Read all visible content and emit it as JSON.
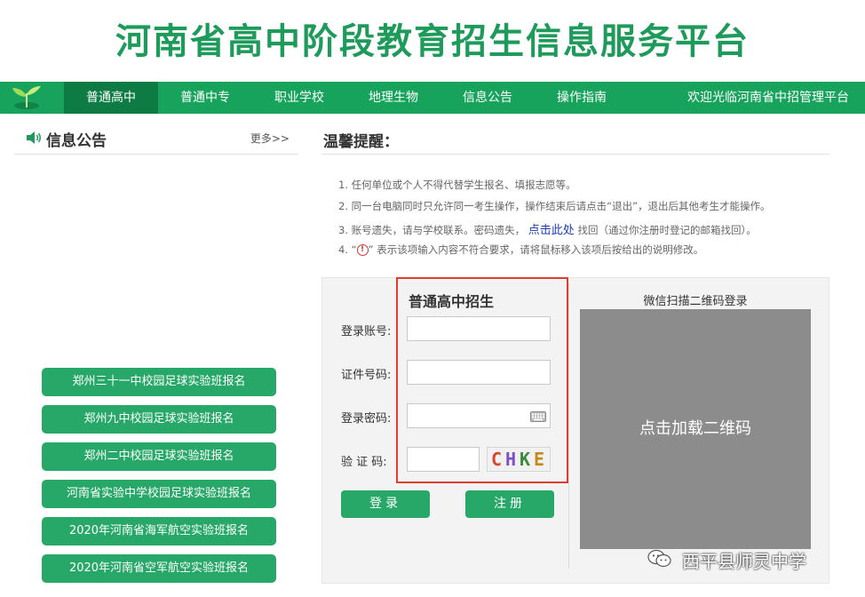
{
  "header": {
    "title": "河南省高中阶段教育招生信息服务平台"
  },
  "nav": {
    "items": [
      {
        "label": "普通高中",
        "active": true
      },
      {
        "label": "普通中专",
        "active": false
      },
      {
        "label": "职业学校",
        "active": false
      },
      {
        "label": "地理生物",
        "active": false
      },
      {
        "label": "信息公告",
        "active": false
      },
      {
        "label": "操作指南",
        "active": false
      }
    ],
    "welcome": "欢迎光临河南省中招管理平台"
  },
  "notice": {
    "title": "信息公告",
    "more": "更多>>"
  },
  "side_buttons": [
    "郑州三十一中校园足球实验班报名",
    "郑州九中校园足球实验班报名",
    "郑州二中校园足球实验班报名",
    "河南省实验中学校园足球实验班报名",
    "2020年河南省海军航空实验班报名",
    "2020年河南省空军航空实验班报名"
  ],
  "tips": {
    "title": "温馨提醒：",
    "line1": "1. 任何单位或个人不得代替学生报名、填报志愿等。",
    "line2": "2. 同一台电脑同时只允许同一考生操作，操作结束后请点击“退出”，退出后其他考生才能操作。",
    "line3_pre": "3. 账号遗失，请与学校联系。密码遗失，",
    "line3_link": "点击此处",
    "line3_post": "找回（通过你注册时登记的邮箱找回）。",
    "line4_pre": "4. “",
    "line4_icon": "!",
    "line4_post": "” 表示该项输入内容不符合要求，请将鼠标移入该项后按给出的说明修改。"
  },
  "login": {
    "title": "普通高中招生",
    "account_label": "登录账号:",
    "id_label": "证件号码:",
    "password_label": "登录密码:",
    "captcha_label": "验 证 码:",
    "captcha_chars": [
      "C",
      "H",
      "K",
      "E"
    ],
    "login_button": "登录",
    "register_button": "注册"
  },
  "qr": {
    "label": "微信扫描二维码登录",
    "load_text": "点击加载二维码"
  },
  "watermark": {
    "text": "西平县师灵中学"
  },
  "colors": {
    "brand_green": "#18a35c",
    "nav_active": "#0d7b43",
    "button_green": "#27a868",
    "highlight_red": "#e23b32",
    "qr_gray": "#8c8c8c",
    "link_blue": "#1b3fb5"
  }
}
